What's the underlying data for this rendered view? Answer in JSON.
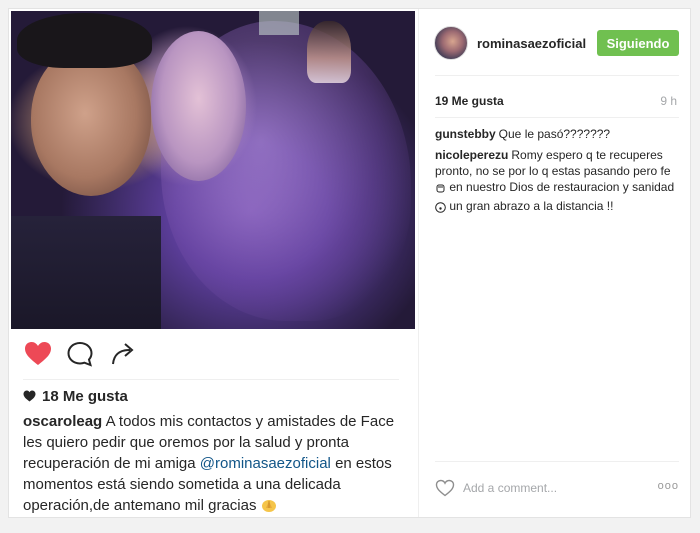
{
  "post": {
    "username": "rominasaezoficial",
    "follow_label": "Siguiendo",
    "likes_right": "19 Me gusta",
    "time_right": "9 h",
    "likes_left": "18 Me gusta",
    "caption": {
      "author": "oscaroleag",
      "text_part1": "A todos mis contactos y amistades de Face les quiero pedir que oremos por la salud y pronta recuperación de mi amiga",
      "mention": "@rominasaezoficial",
      "text_part2": "en estos momentos está siendo sometida a una delicada operación,de antemano mil gracias"
    },
    "comments": [
      {
        "user": "gunstebby",
        "text": "Que le pasó???????"
      },
      {
        "user": "nicoleperezu",
        "text_part1": "Romy espero q te recuperes pronto, no se por lo q estas pasando pero fe",
        "text_part2": "en nuestro Dios de restauracion y sanidad",
        "text_part3": "un gran abrazo a la distancia !!"
      }
    ],
    "comment_placeholder": "Add a comment...",
    "more_label": "ooo"
  },
  "colors": {
    "like_red": "#ed4956",
    "follow_green": "#70c050",
    "mention_blue": "#125688",
    "meta_gray": "#a5a7aa"
  },
  "icons": {
    "like": "heart-filled-icon",
    "comment": "speech-bubble-icon",
    "share": "share-arrow-icon",
    "likes_marker": "small-heart-icon",
    "comment_like": "heart-outline-icon",
    "caption_emoji": "folded-hands-emoji",
    "comment_emoji_1": "fist-emoji",
    "comment_emoji_2": "kiss-face-emoji"
  }
}
